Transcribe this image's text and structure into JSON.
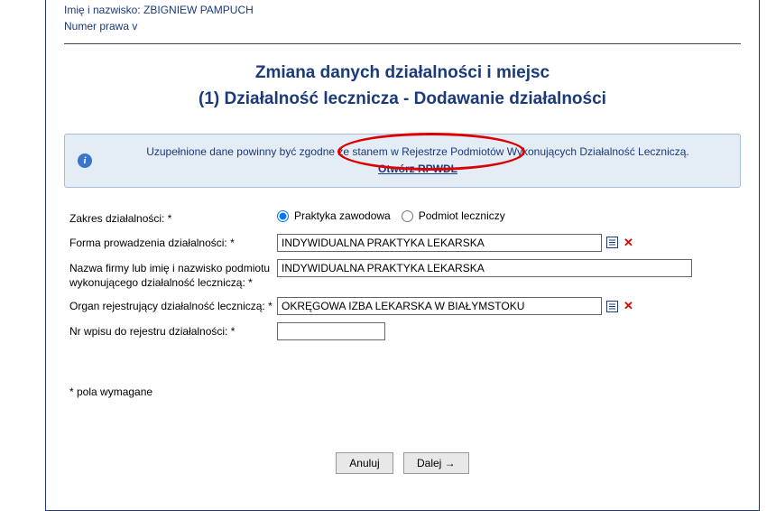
{
  "header": {
    "line1": "Imię i nazwisko: ZBIGNIEW PAMPUCH",
    "line2": "Numer prawa v"
  },
  "title": {
    "line1": "Zmiana danych działalności i miejsc",
    "line2": "(1) Działalność lecznicza - Dodawanie działalności"
  },
  "info": {
    "text": "Uzupełnione dane powinny być zgodne ze stanem w Rejestrze Podmiotów Wykonujących Działalność Leczniczą.",
    "link": "Otwórz RPWDL"
  },
  "form": {
    "zakres_label": "Zakres działalności: *",
    "zakres_opt1": "Praktyka zawodowa",
    "zakres_opt2": "Podmiot leczniczy",
    "forma_label": "Forma prowadzenia działalności: *",
    "forma_value": "INDYWIDUALNA PRAKTYKA LEKARSKA",
    "nazwa_label": "Nazwa firmy lub imię i nazwisko podmiotu wykonującego działalność leczniczą: *",
    "nazwa_value": "INDYWIDUALNA PRAKTYKA LEKARSKA",
    "organ_label": "Organ rejestrujący działalność leczniczą: *",
    "organ_value": "OKRĘGOWA IZBA LEKARSKA W BIAŁYMSTOKU",
    "nrwpisu_label": "Nr wpisu do rejestru działalności: *",
    "nrwpisu_value": ""
  },
  "required_note": "* pola wymagane",
  "buttons": {
    "cancel": "Anuluj",
    "next": "Dalej →"
  }
}
